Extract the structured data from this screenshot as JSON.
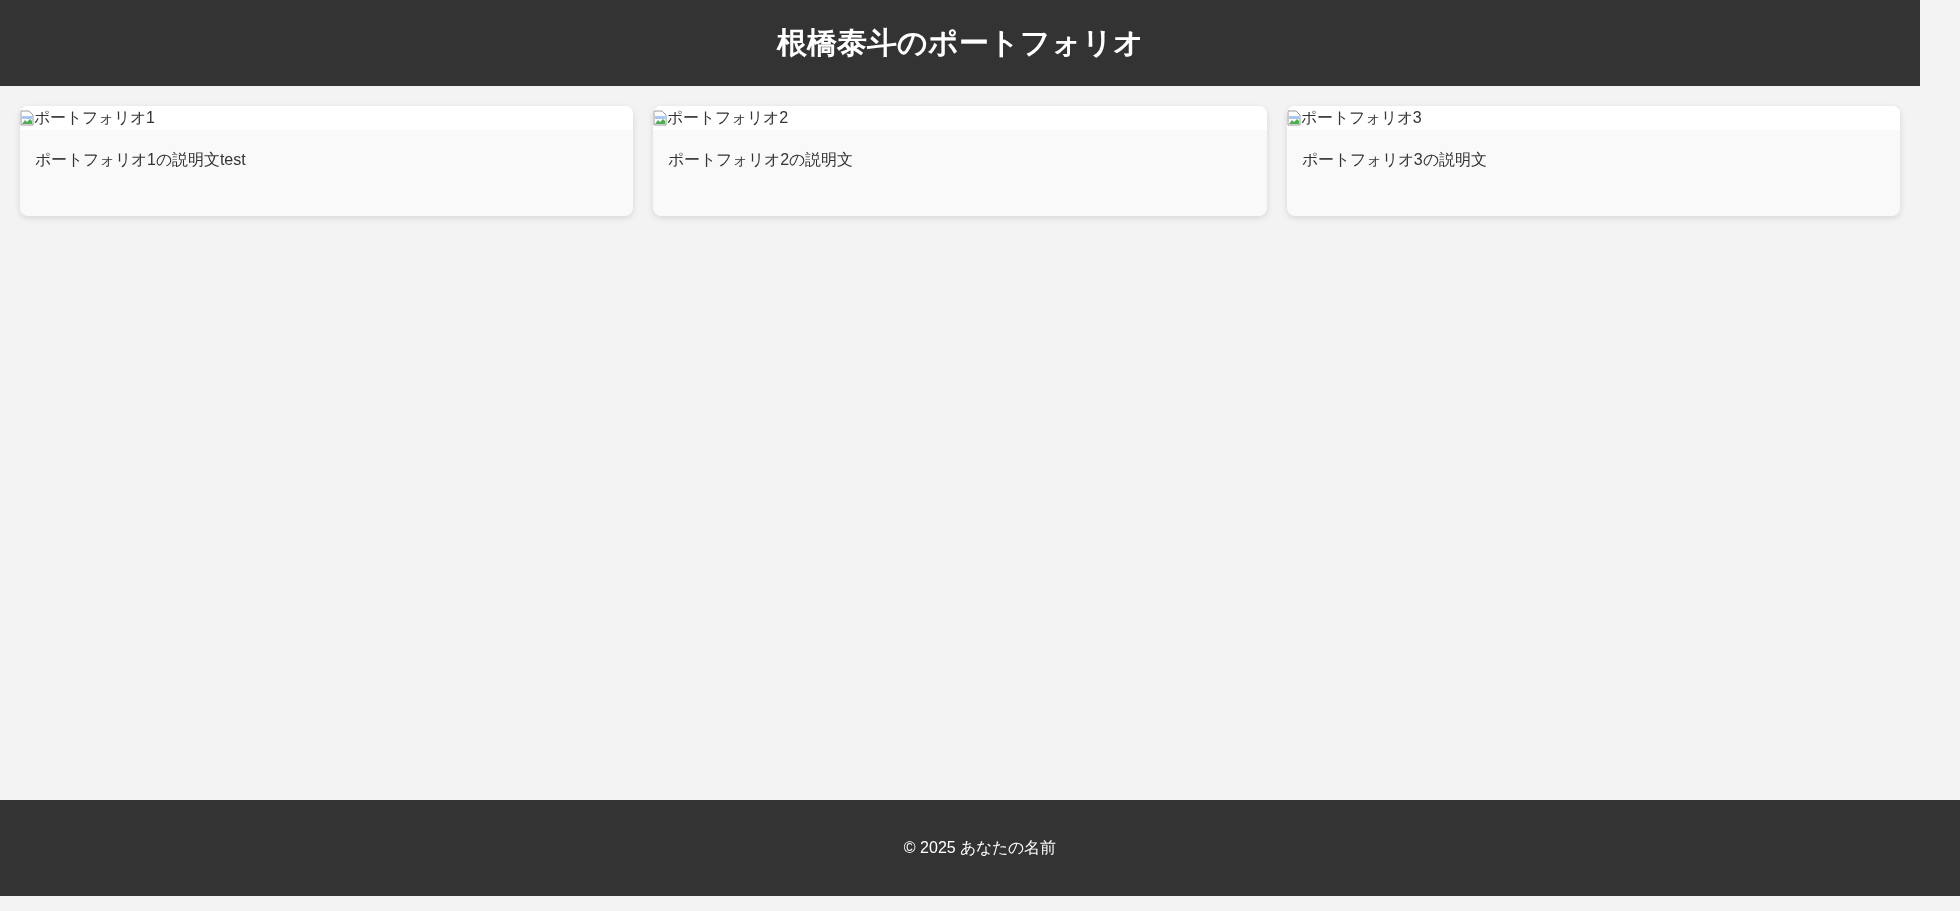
{
  "header": {
    "title": "根橋泰斗のポートフォリオ"
  },
  "cards": [
    {
      "image_alt": "ポートフォリオ1",
      "description": "ポートフォリオ1の説明文test"
    },
    {
      "image_alt": "ポートフォリオ2",
      "description": "ポートフォリオ2の説明文"
    },
    {
      "image_alt": "ポートフォリオ3",
      "description": "ポートフォリオ3の説明文"
    }
  ],
  "footer": {
    "text": "© 2025 あなたの名前"
  }
}
